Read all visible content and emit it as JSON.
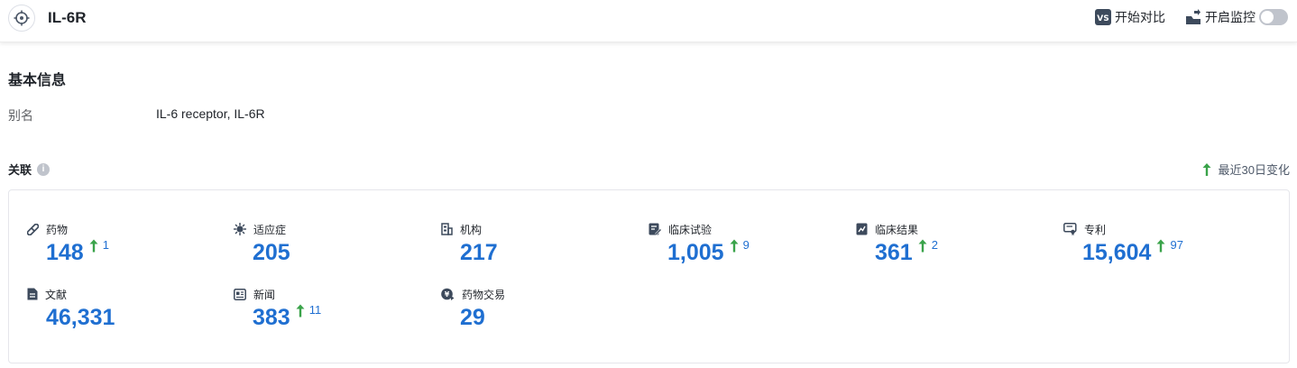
{
  "header": {
    "title": "IL-6R",
    "compare_label": "开始对比",
    "compare_badge": "VS",
    "monitor_label": "开启监控",
    "monitor_enabled": false
  },
  "basic_info": {
    "section_title": "基本信息",
    "alias_label": "别名",
    "alias_value": "IL-6 receptor,  IL-6R"
  },
  "related": {
    "title": "关联",
    "info_glyph": "i",
    "recent_change_label": "最近30日变化",
    "accent_color": "#1f6fd1",
    "up_color": "#3aa34a",
    "stats": [
      {
        "label": "药物",
        "value": "148",
        "delta": "1",
        "icon": "pill-icon"
      },
      {
        "label": "适应症",
        "value": "205",
        "delta": null,
        "icon": "virus-icon"
      },
      {
        "label": "机构",
        "value": "217",
        "delta": null,
        "icon": "building-icon"
      },
      {
        "label": "临床试验",
        "value": "1,005",
        "delta": "9",
        "icon": "clinical-trial-icon"
      },
      {
        "label": "临床结果",
        "value": "361",
        "delta": "2",
        "icon": "chart-doc-icon"
      },
      {
        "label": "专利",
        "value": "15,604",
        "delta": "97",
        "icon": "patent-icon"
      },
      {
        "label": "文献",
        "value": "46,331",
        "delta": null,
        "icon": "document-icon"
      },
      {
        "label": "新闻",
        "value": "383",
        "delta": "11",
        "icon": "news-icon"
      },
      {
        "label": "药物交易",
        "value": "29",
        "delta": null,
        "icon": "deal-icon"
      }
    ]
  }
}
